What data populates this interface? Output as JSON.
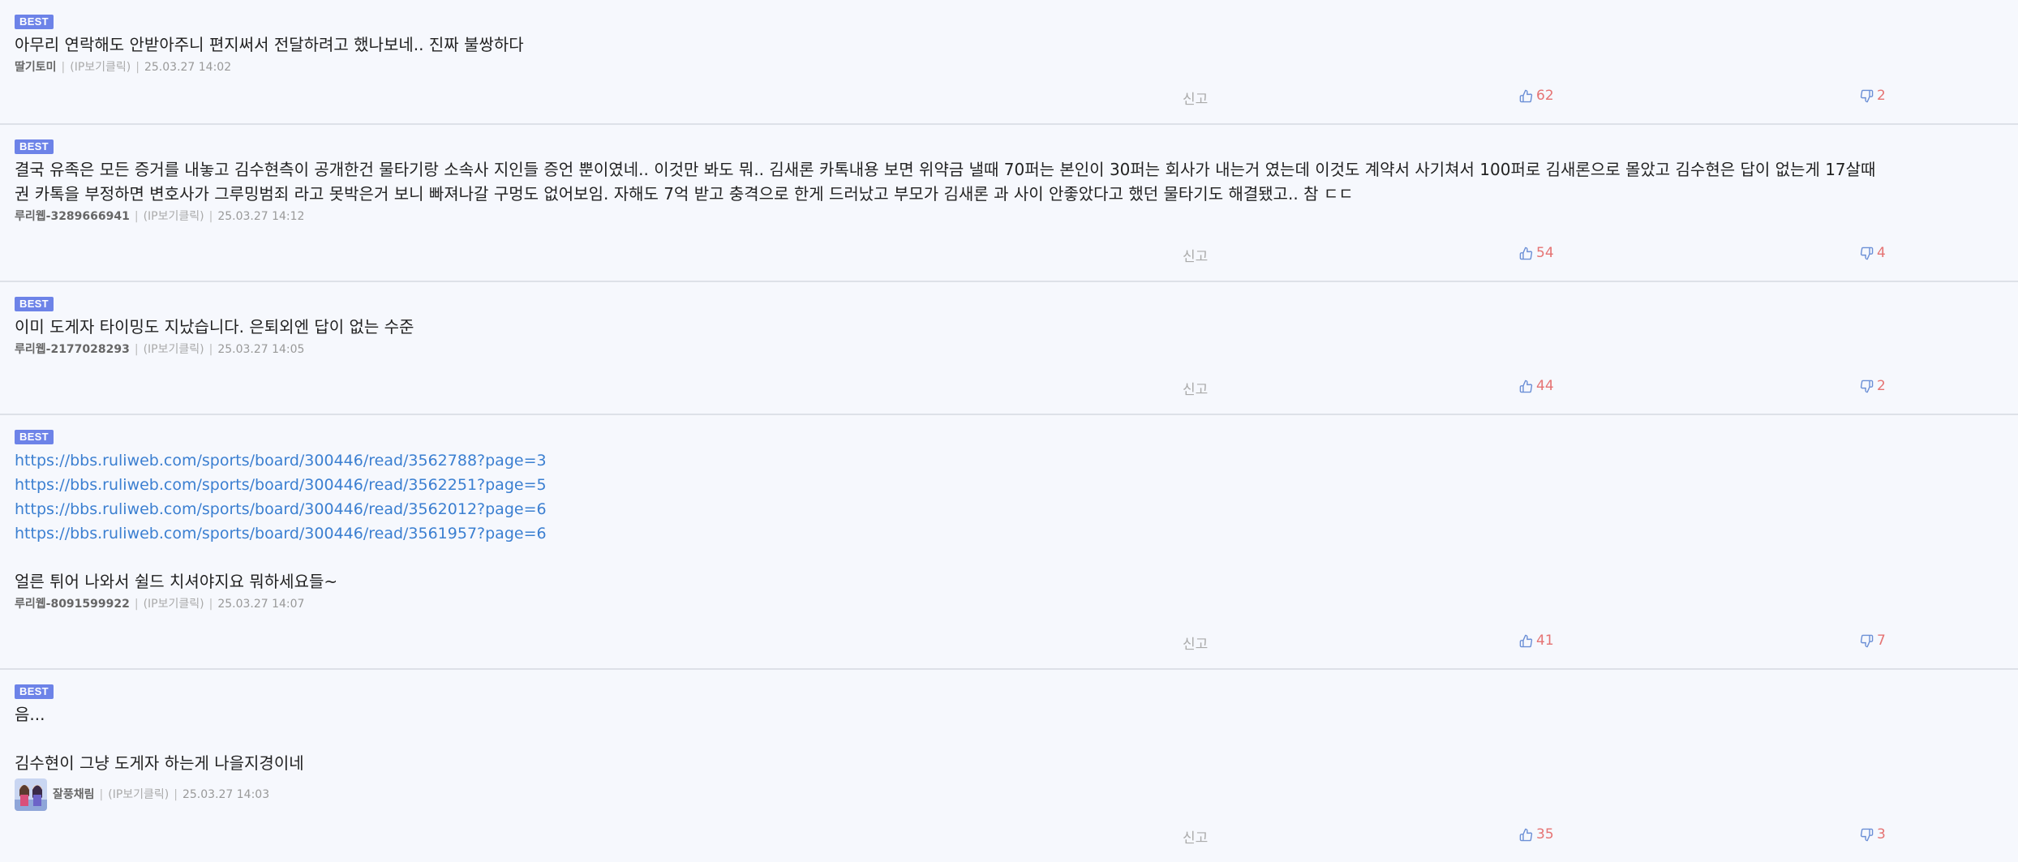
{
  "comments": [
    {
      "badge": "BEST",
      "lines": [
        "아무리 연락해도 안받아주니 편지써서 전달하려고 했나보네.. 진짜 불쌍하다"
      ],
      "author": "딸기토미",
      "ip": "(IP보기클릭)",
      "time": "25.03.27 14:02",
      "report": "신고",
      "likes": "62",
      "dislikes": "2"
    },
    {
      "badge": "BEST",
      "lines": [
        "결국 유족은 모든 증거를 내놓고 김수현측이 공개한건 물타기랑 소속사 지인들 증언 뿐이였네.. 이것만 봐도 뭐.. 김새론 카톡내용 보면 위약금 낼때 70퍼는 본인이 30퍼는 회사가 내는거 였는데 이것도 계약서 사기쳐서 100퍼로 김새론으로 몰았고 김수현은 답이 없는게 17살때",
        "권 카톡을 부정하면 변호사가 그루밍범죄 라고 못박은거 보니 빠져나갈 구멍도 없어보임. 자해도 7억 받고 충격으로 한게 드러났고 부모가 김새론 과 사이 안좋았다고 했던 물타기도 해결됐고.. 참 ㄷㄷ"
      ],
      "author": "루리웹-3289666941",
      "ip": "(IP보기클릭)",
      "time": "25.03.27 14:12",
      "report": "신고",
      "likes": "54",
      "dislikes": "4"
    },
    {
      "badge": "BEST",
      "lines": [
        "이미 도게자 타이밍도 지났습니다. 은퇴외엔 답이 없는 수준"
      ],
      "author": "루리웹-2177028293",
      "ip": "(IP보기클릭)",
      "time": "25.03.27 14:05",
      "report": "신고",
      "likes": "44",
      "dislikes": "2"
    },
    {
      "badge": "BEST",
      "links": [
        "https://bbs.ruliweb.com/sports/board/300446/read/3562788?page=3",
        "https://bbs.ruliweb.com/sports/board/300446/read/3562251?page=5",
        "https://bbs.ruliweb.com/sports/board/300446/read/3562012?page=6",
        "https://bbs.ruliweb.com/sports/board/300446/read/3561957?page=6"
      ],
      "lines": [
        "얼른 튀어 나와서 쉴드 치셔야지요 뭐하세요들~"
      ],
      "author": "루리웹-8091599922",
      "ip": "(IP보기클릭)",
      "time": "25.03.27 14:07",
      "report": "신고",
      "likes": "41",
      "dislikes": "7"
    },
    {
      "badge": "BEST",
      "lines": [
        "음...",
        "",
        "김수현이 그냥 도게자 하는게 나을지경이네"
      ],
      "author": "잘풍채림",
      "ip": "(IP보기클릭)",
      "time": "25.03.27 14:03",
      "report": "신고",
      "likes": "35",
      "dislikes": "3",
      "has_avatar": true
    }
  ],
  "icons": {
    "like": "thumbs-up-icon",
    "dislike": "thumbs-down-icon",
    "avatar": "user-avatar"
  },
  "colors": {
    "badge": "#6d83e8",
    "link": "#3b7fd1",
    "like_icon": "#6b8fd6",
    "count": "#e57373",
    "background": "#f6f8fd"
  }
}
